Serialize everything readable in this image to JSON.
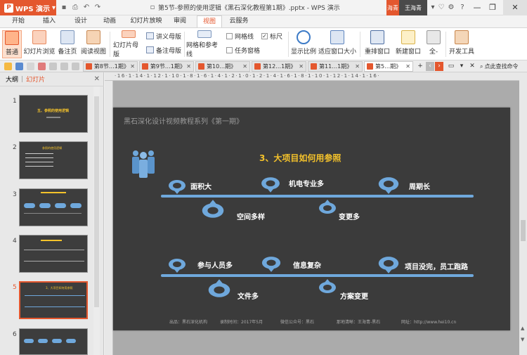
{
  "app": {
    "button_label": "WPS 演示",
    "window_title": "第5节-参照的使用逻辑《黑石深化教程第1期》.pptx - WPS 演示",
    "user_badge": "海青",
    "user_name": "王海青"
  },
  "menu_tabs": [
    "开始",
    "插入",
    "设计",
    "动画",
    "幻灯片放映",
    "审阅",
    "视图",
    "云服务"
  ],
  "active_tab": "视图",
  "ribbon": {
    "normal": "普通",
    "sorter": "幻灯片浏览",
    "notes_page": "备注页",
    "reading_view": "阅读视图",
    "slide_master": "幻灯片母版",
    "handout_master": "讲义母版",
    "notes_master": "备注母版",
    "grid_guides": "网格和参考线",
    "gridlines": "网格线",
    "ruler": "标尺",
    "task_pane": "任务窗格",
    "zoom": "显示比例",
    "fit_window": "适应窗口大小",
    "rearrange": "重排窗口",
    "new_window": "新建窗口",
    "more": "全-",
    "dev_tools": "开发工具"
  },
  "doc_tabs": [
    "第8节…1期》",
    "第9节…1期》",
    "第10…期》",
    "第12…1期》",
    "第11…1期》",
    "第5…期》"
  ],
  "cmd_search": "点此查找命令",
  "left_pane": {
    "outline": "大纲",
    "slides": "幻灯片",
    "slide_numbers": [
      "1",
      "2",
      "3",
      "4",
      "5",
      "6"
    ],
    "selected": "5"
  },
  "ruler_text": "·16·1·14·1·12·1·10·1·8·1·6·1·4·1·2·1·0·1·2·1·4·1·6·1·8·1·10·1·12·1·14·1·16·",
  "slide": {
    "header": "黑石深化设计视频教程系列《第一期》",
    "title": "3、大项目如何用参照",
    "labels_row1_top": [
      "面积大",
      "机电专业多",
      "周期长"
    ],
    "labels_row1_bottom": [
      "空间多样",
      "变更多"
    ],
    "labels_row2_top": [
      "参与人员多",
      "信息复杂",
      "项目没完，员工跑路"
    ],
    "labels_row2_bottom": [
      "文件多",
      "方案变更"
    ],
    "footer": [
      "出品：黑石深化机构",
      "录制时间：2017年5月",
      "微信公众号：黑石",
      "那地清晰：王海青-黑石",
      "网址：http://www.hei10.cn"
    ]
  },
  "thumbnail_titles": [
    "五、参照的使用逻辑",
    "参照的使用逻辑",
    "",
    "",
    "3、大项目如何用参照",
    ""
  ],
  "colors": {
    "accent": "#e4572e",
    "slide_bg": "#3b3b3b",
    "title": "#f4c22b",
    "line": "#6fa8dc",
    "pin": "#6fa8dc"
  }
}
